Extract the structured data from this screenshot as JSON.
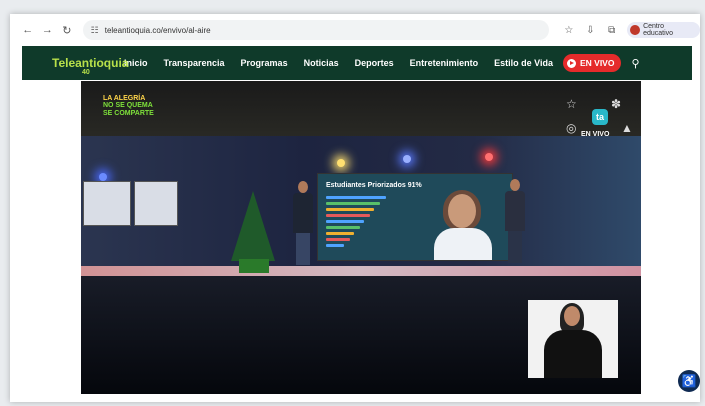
{
  "browser": {
    "url": "teleantioquia.co/envivo/al-aire",
    "profile_label": "Centro educativo",
    "icons": [
      "back-icon",
      "forward-icon",
      "reload-icon",
      "site-settings-icon",
      "star-icon",
      "download-icon",
      "extensions-icon"
    ]
  },
  "site": {
    "logo_text": "Teleantioquia",
    "logo_sub": "40",
    "nav": [
      "Inicio",
      "Transparencia",
      "Programas",
      "Noticias",
      "Deportes",
      "Entretenimiento",
      "Estilo de Vida"
    ],
    "live_label": "EN VIVO"
  },
  "player": {
    "brand_line1": "LA ALEGRÍA",
    "brand_line2": "NO SE QUEMA",
    "brand_line3": "SE COMPARTE",
    "corner_logo": "ta",
    "corner_label": "EN VIVO",
    "screen_title": "Estudiantes Priorizados",
    "screen_suffix": "91%"
  }
}
